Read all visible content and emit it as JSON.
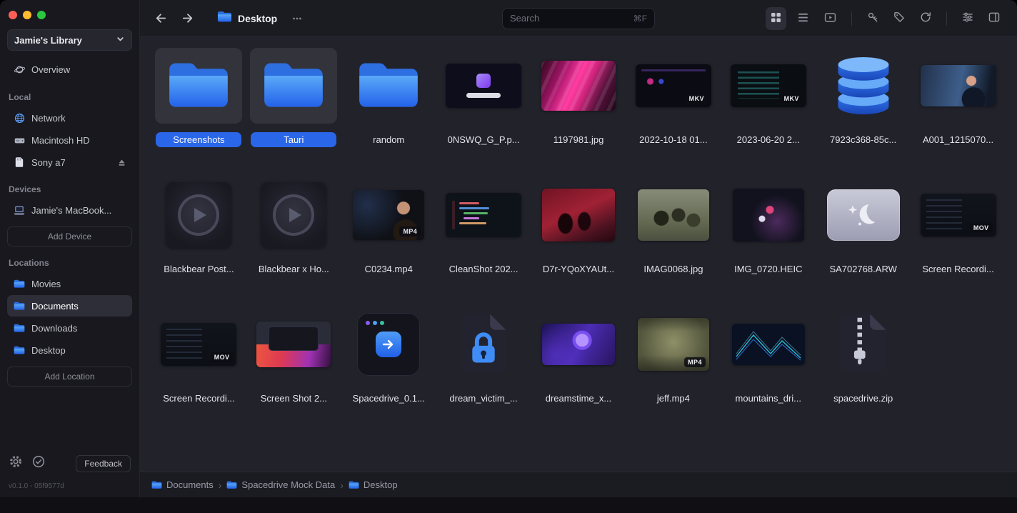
{
  "window": {
    "traffic_lights": [
      "close",
      "minimize",
      "maximize"
    ]
  },
  "sidebar": {
    "library_name": "Jamie's Library",
    "overview_label": "Overview",
    "sections": [
      {
        "title": "Local",
        "items": [
          {
            "label": "Network",
            "icon": "globe-icon"
          },
          {
            "label": "Macintosh HD",
            "icon": "hard-drive-icon"
          },
          {
            "label": "Sony a7",
            "icon": "sd-card-icon",
            "trailing": "eject-icon"
          }
        ]
      },
      {
        "title": "Devices",
        "items": [
          {
            "label": "Jamie's MacBook...",
            "icon": "laptop-icon"
          }
        ],
        "action": "Add Device"
      },
      {
        "title": "Locations",
        "items": [
          {
            "label": "Movies",
            "icon": "folder-icon"
          },
          {
            "label": "Documents",
            "icon": "folder-icon",
            "selected": true
          },
          {
            "label": "Downloads",
            "icon": "folder-icon"
          },
          {
            "label": "Desktop",
            "icon": "folder-icon"
          }
        ],
        "action": "Add Location"
      }
    ],
    "feedback_label": "Feedback",
    "version": "v0.1.0 - 05f9577d"
  },
  "topbar": {
    "title": "Desktop",
    "search": {
      "placeholder": "Search",
      "shortcut": "⌘F",
      "value": ""
    },
    "view_modes": [
      "grid-view",
      "list-view",
      "media-view"
    ],
    "tools": [
      "key-icon",
      "tag-icon",
      "refresh-icon",
      "sliders-icon",
      "panel-toggle-icon"
    ]
  },
  "grid": {
    "items": [
      {
        "name": "Screenshots",
        "kind": "folder",
        "selected": true
      },
      {
        "name": "Tauri",
        "kind": "folder",
        "selected": true
      },
      {
        "name": "random",
        "kind": "folder"
      },
      {
        "name": "0NSWQ_G_P.p...",
        "kind": "app-screenshot"
      },
      {
        "name": "1197981.jpg",
        "kind": "pink-image"
      },
      {
        "name": "2022-10-18 01...",
        "kind": "dark-screenshot",
        "badge": "MKV"
      },
      {
        "name": "2023-06-20 2...",
        "kind": "terminal-screenshot",
        "badge": "MKV"
      },
      {
        "name": "7923c368-85c...",
        "kind": "database-icon"
      },
      {
        "name": "A001_1215070...",
        "kind": "photo-person"
      },
      {
        "name": "Blackbear Post...",
        "kind": "video-placeholder"
      },
      {
        "name": "Blackbear x Ho...",
        "kind": "video-placeholder"
      },
      {
        "name": "C0234.mp4",
        "kind": "video-thumb-face",
        "badge": "MP4"
      },
      {
        "name": "CleanShot 202...",
        "kind": "code-screenshot"
      },
      {
        "name": "D7r-YQoXYAUt...",
        "kind": "red-artwork"
      },
      {
        "name": "IMAG0068.jpg",
        "kind": "photo-group"
      },
      {
        "name": "IMG_0720.HEIC",
        "kind": "dark-photo"
      },
      {
        "name": "SA702768.ARW",
        "kind": "raw-thumb"
      },
      {
        "name": "Screen Recordi...",
        "kind": "dark-screenshot-wide",
        "badge": "MOV"
      },
      {
        "name": "Screen Recordi...",
        "kind": "dark-screenshot-wide",
        "badge": "MOV"
      },
      {
        "name": "Screen Shot 2...",
        "kind": "mac-screenshot"
      },
      {
        "name": "Spacedrive_0.1...",
        "kind": "dmg-icon"
      },
      {
        "name": "dream_victim_...",
        "kind": "file-lock-icon"
      },
      {
        "name": "dreamstime_x...",
        "kind": "purple-artwork"
      },
      {
        "name": "jeff.mp4",
        "kind": "video-room",
        "badge": "MP4"
      },
      {
        "name": "mountains_dri...",
        "kind": "wireframe-mountains"
      },
      {
        "name": "spacedrive.zip",
        "kind": "zip-icon"
      }
    ]
  },
  "breadcrumb": {
    "separator": "›",
    "items": [
      "Documents",
      "Spacedrive Mock Data",
      "Desktop"
    ]
  },
  "colors": {
    "accent": "#2a66e8",
    "folder_blue_top": "#5aa9f8",
    "folder_blue_bottom": "#2463ea"
  }
}
